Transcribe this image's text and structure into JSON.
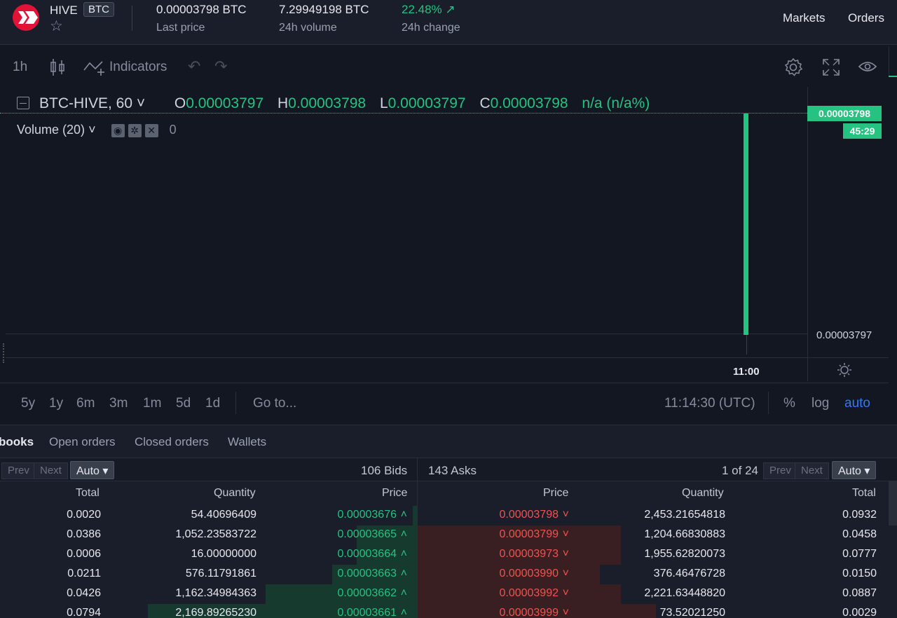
{
  "header": {
    "pair_base": "HIVE",
    "pair_quote": "BTC",
    "last_price": "0.00003798 BTC",
    "last_price_label": "Last price",
    "volume_24h": "7.29949198 BTC",
    "volume_24h_label": "24h volume",
    "change_24h": "22.48%",
    "change_24h_label": "24h change",
    "nav": [
      "Markets",
      "Orders"
    ]
  },
  "chart_toolbar": {
    "interval": "1h",
    "indicators_label": "Indicators"
  },
  "chart": {
    "symbol": "BTC-HIVE, 60",
    "open_label": "O",
    "open": "0.00003797",
    "high_label": "H",
    "high": "0.00003798",
    "low_label": "L",
    "low": "0.00003797",
    "close_label": "C",
    "close": "0.00003798",
    "change": "n/a (n/a%)",
    "volume_study": "Volume (20)",
    "volume_value": "0",
    "current_price_tag": "0.00003798",
    "countdown_tag": "45:29",
    "axis_price_low": "0.00003797",
    "time_tick": "11:00",
    "accent_color": "#26c281"
  },
  "range_bar": {
    "ranges": [
      "5y",
      "1y",
      "6m",
      "3m",
      "1m",
      "5d",
      "1d"
    ],
    "goto": "Go to...",
    "clock": "11:14:30 (UTC)",
    "percent": "%",
    "log": "log",
    "auto": "auto"
  },
  "tabs": [
    "books",
    "Open orders",
    "Closed orders",
    "Wallets"
  ],
  "orderbook": {
    "prev": "Prev",
    "next": "Next",
    "auto": "Auto",
    "bids_count": "106 Bids",
    "asks_count": "143 Asks",
    "page": "1 of 24",
    "bid_headers": [
      "Total",
      "Quantity",
      "Price"
    ],
    "ask_headers": [
      "Price",
      "Quantity",
      "Total"
    ],
    "bids": [
      {
        "total": "0.0020",
        "quantity": "54.40696409",
        "price": "0.00003676"
      },
      {
        "total": "0.0386",
        "quantity": "1,052.23583722",
        "price": "0.00003665"
      },
      {
        "total": "0.0006",
        "quantity": "16.00000000",
        "price": "0.00003664"
      },
      {
        "total": "0.0211",
        "quantity": "576.11791861",
        "price": "0.00003663"
      },
      {
        "total": "0.0426",
        "quantity": "1,162.34984363",
        "price": "0.00003662"
      },
      {
        "total": "0.0794",
        "quantity": "2,169.89265230",
        "price": "0.00003661"
      }
    ],
    "asks": [
      {
        "price": "0.00003798",
        "quantity": "2,453.21654818",
        "total": "0.0932"
      },
      {
        "price": "0.00003799",
        "quantity": "1,204.66830883",
        "total": "0.0458"
      },
      {
        "price": "0.00003973",
        "quantity": "1,955.62820073",
        "total": "0.0777"
      },
      {
        "price": "0.00003990",
        "quantity": "376.46476728",
        "total": "0.0150"
      },
      {
        "price": "0.00003992",
        "quantity": "2,221.63448820",
        "total": "0.0887"
      },
      {
        "price": "0.00003999",
        "quantity": "73.52021250",
        "total": "0.0029"
      }
    ]
  }
}
